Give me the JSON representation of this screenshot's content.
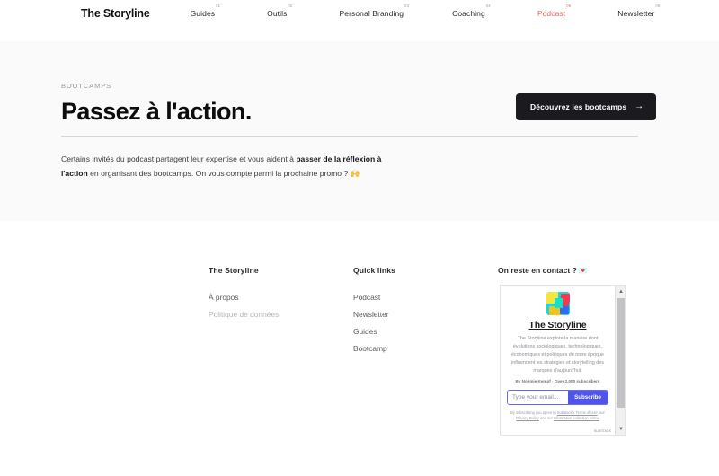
{
  "nav": {
    "brand": "The Storyline",
    "items": [
      {
        "label": "Guides",
        "num": "01"
      },
      {
        "label": "Outils",
        "num": "02"
      },
      {
        "label": "Personal Branding",
        "num": "03"
      },
      {
        "label": "Coaching",
        "num": "04"
      },
      {
        "label": "Podcast",
        "num": "05"
      },
      {
        "label": "Newsletter",
        "num": "06"
      }
    ],
    "active_color": "#f4615c"
  },
  "hero": {
    "eyebrow": "BOOTCAMPS",
    "title": "Passez à l'action.",
    "cta_label": "Découvrez les bootcamps",
    "cta_arrow": "→",
    "copy_part1": "Certains invités du podcast partagent leur expertise et vous aident à ",
    "copy_bold": "passer de la réflexion à l'action",
    "copy_part2": " en organisant des bootcamps. On vous compte parmi la prochaine promo ? 🙌",
    "background": "#fafafa"
  },
  "footer": {
    "brand_column": {
      "title": "The Storyline",
      "links": [
        {
          "label": "À propos",
          "muted": false
        },
        {
          "label": "Politique de données",
          "muted": true
        }
      ]
    },
    "quick_column": {
      "title": "Quick links",
      "links": [
        {
          "label": "Podcast"
        },
        {
          "label": "Newsletter"
        },
        {
          "label": "Guides"
        },
        {
          "label": "Bootcamp"
        }
      ]
    },
    "contact": {
      "title": "On reste en contact ?",
      "emoji": "💌"
    }
  },
  "embed": {
    "title": "The Storyline",
    "description": "The Storyline explore la manière dont évolutions sociologiques, technologiques, économiques et politiques de notre époque influencent les stratégies et storytelling des marques d'aujourd'hui.",
    "byline": "By Noémie Kempf · Over 2,000 subscribers",
    "input_placeholder": "Type your email...",
    "subscribe_label": "Subscribe",
    "fine_print_1": "By subscribing you agree to ",
    "fine_print_terms": "Substack's Terms of Use",
    "fine_print_2": ", our ",
    "fine_print_privacy": "Privacy Policy",
    "fine_print_3": " and our ",
    "fine_print_notice": "Information collection notice",
    "badge": "SUBSTACK",
    "accent": "#4f55e8",
    "scroll_up": "▲",
    "scroll_down": "▼"
  }
}
